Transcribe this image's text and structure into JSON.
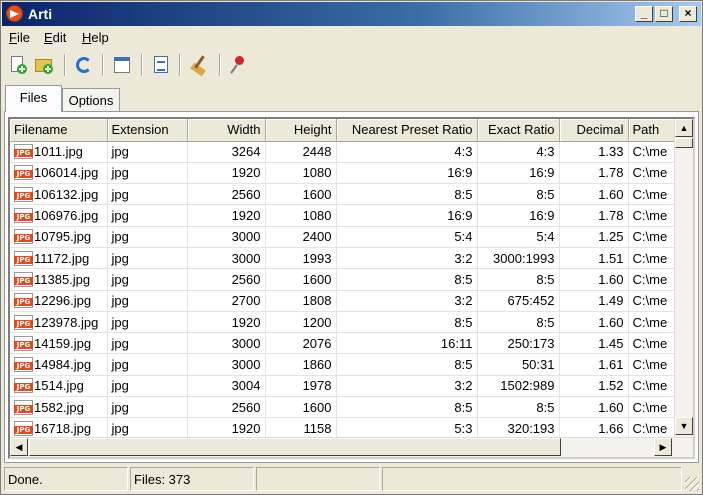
{
  "window": {
    "title": "Arti"
  },
  "menu": [
    "File",
    "Edit",
    "Help"
  ],
  "toolbar": {
    "icons": [
      "add-file-icon",
      "add-folder-icon",
      "refresh-icon",
      "properties-icon",
      "export-icon",
      "clear-icon",
      "pin-icon"
    ]
  },
  "tabs": [
    "Files",
    "Options"
  ],
  "table": {
    "headers": [
      "Filename",
      "Extension",
      "Width",
      "Height",
      "Nearest Preset Ratio",
      "Exact Ratio",
      "Decimal",
      "Path"
    ],
    "rows": [
      [
        "1011.jpg",
        "jpg",
        "3264",
        "2448",
        "4:3",
        "4:3",
        "1.33",
        "C:\\me"
      ],
      [
        "106014.jpg",
        "jpg",
        "1920",
        "1080",
        "16:9",
        "16:9",
        "1.78",
        "C:\\me"
      ],
      [
        "106132.jpg",
        "jpg",
        "2560",
        "1600",
        "8:5",
        "8:5",
        "1.60",
        "C:\\me"
      ],
      [
        "106976.jpg",
        "jpg",
        "1920",
        "1080",
        "16:9",
        "16:9",
        "1.78",
        "C:\\me"
      ],
      [
        "10795.jpg",
        "jpg",
        "3000",
        "2400",
        "5:4",
        "5:4",
        "1.25",
        "C:\\me"
      ],
      [
        "11172.jpg",
        "jpg",
        "3000",
        "1993",
        "3:2",
        "3000:1993",
        "1.51",
        "C:\\me"
      ],
      [
        "11385.jpg",
        "jpg",
        "2560",
        "1600",
        "8:5",
        "8:5",
        "1.60",
        "C:\\me"
      ],
      [
        "12296.jpg",
        "jpg",
        "2700",
        "1808",
        "3:2",
        "675:452",
        "1.49",
        "C:\\me"
      ],
      [
        "123978.jpg",
        "jpg",
        "1920",
        "1200",
        "8:5",
        "8:5",
        "1.60",
        "C:\\me"
      ],
      [
        "14159.jpg",
        "jpg",
        "3000",
        "2076",
        "16:11",
        "250:173",
        "1.45",
        "C:\\me"
      ],
      [
        "14984.jpg",
        "jpg",
        "3000",
        "1860",
        "8:5",
        "50:31",
        "1.61",
        "C:\\me"
      ],
      [
        "1514.jpg",
        "jpg",
        "3004",
        "1978",
        "3:2",
        "1502:989",
        "1.52",
        "C:\\me"
      ],
      [
        "1582.jpg",
        "jpg",
        "2560",
        "1600",
        "8:5",
        "8:5",
        "1.60",
        "C:\\me"
      ],
      [
        "16718.jpg",
        "jpg",
        "1920",
        "1158",
        "5:3",
        "320:193",
        "1.66",
        "C:\\me"
      ]
    ]
  },
  "status": {
    "message": "Done.",
    "files": "Files: 373",
    "empty1": "",
    "empty2": ""
  }
}
